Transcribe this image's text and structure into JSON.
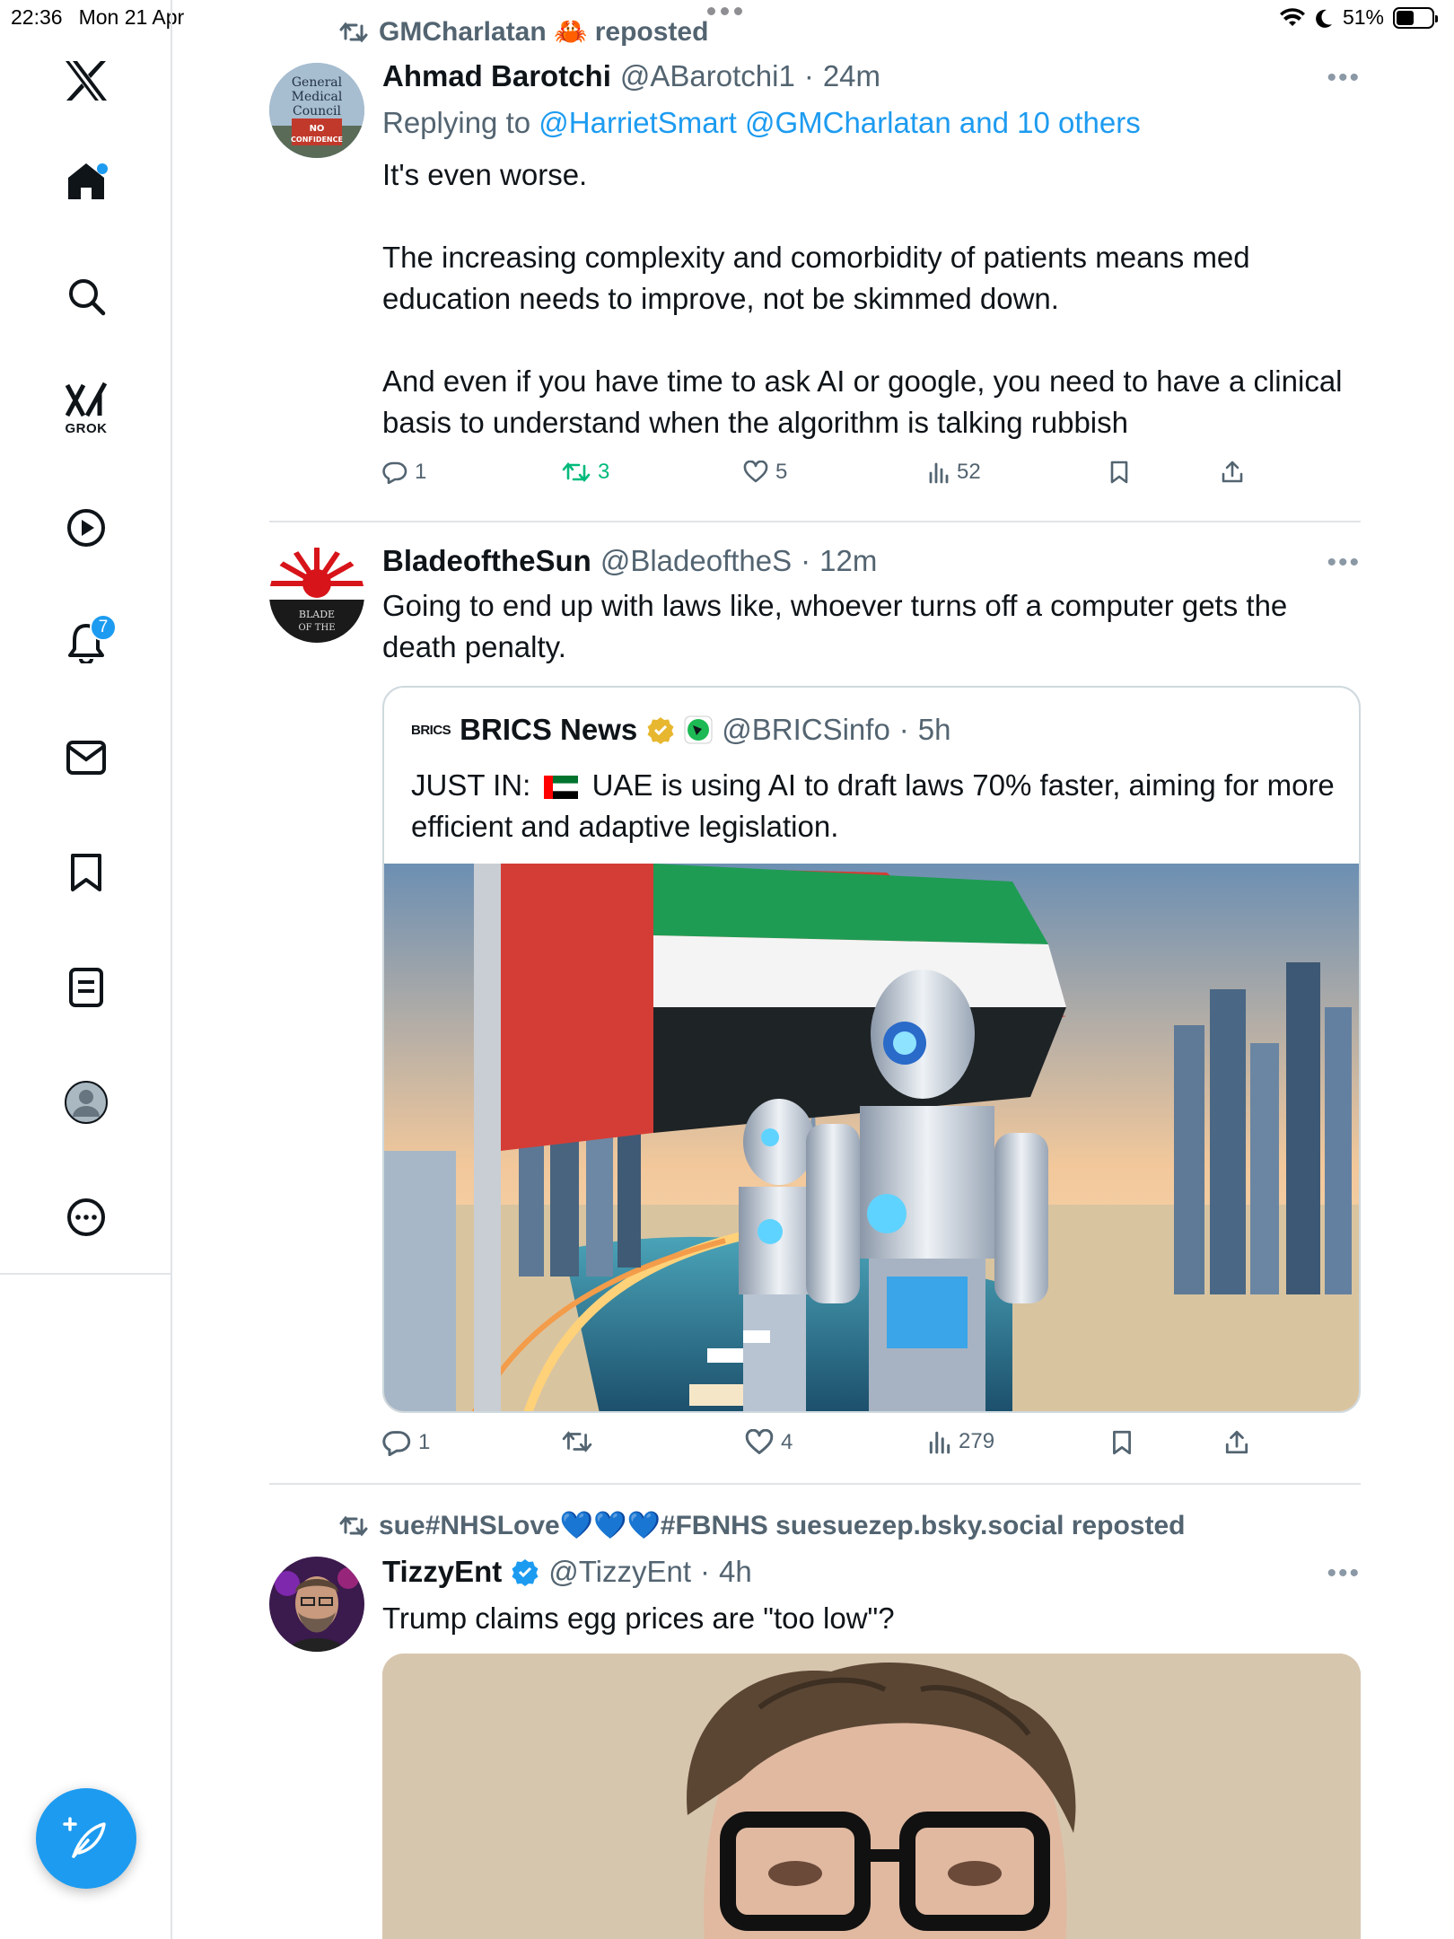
{
  "status_bar": {
    "time": "22:36",
    "date": "Mon 21 Apr",
    "battery": "51%"
  },
  "sidebar": {
    "items": [
      {
        "name": "x-logo"
      },
      {
        "name": "home"
      },
      {
        "name": "search"
      },
      {
        "name": "grok",
        "label": "GROK"
      },
      {
        "name": "videos"
      },
      {
        "name": "notifications",
        "badge": "7"
      },
      {
        "name": "messages"
      },
      {
        "name": "bookmarks"
      },
      {
        "name": "lists"
      },
      {
        "name": "profile"
      },
      {
        "name": "more"
      }
    ]
  },
  "posts": [
    {
      "repost_by": "GMCharlatan 🦀 reposted",
      "author": "Ahmad Barotchi",
      "handle": "@ABarotchi1",
      "time": "24m",
      "avatar_text": [
        "General",
        "Medical",
        "Council",
        "NO",
        "CONFIDENCE"
      ],
      "reply_prefix": "Replying to ",
      "reply_targets": "@HarrietSmart @GMCharlatan and 10 others",
      "text": "It's even worse.\n\nThe increasing complexity and comorbidity of patients means med education needs to improve, not be skimmed down.\n\nAnd even if you have time to ask AI or google, you need to have a clinical basis to understand when the algorithm is talking rubbish",
      "replies": "1",
      "reposts": "3",
      "likes": "5",
      "views": "52"
    },
    {
      "author": "BladeoftheSun",
      "handle": "@BladeoftheS",
      "time": "12m",
      "avatar_text": [
        "BLADE",
        "OF THE"
      ],
      "text": "Going to end up with laws like, whoever turns off a computer gets the death penalty.",
      "quote": {
        "logo": "BRICS",
        "author": "BRICS News",
        "handle": "@BRICSinfo",
        "time": "5h",
        "text_prefix": "JUST IN:",
        "text_body": "UAE is using AI to draft laws 70% faster, aiming for more efficient and adaptive legislation."
      },
      "replies": "1",
      "reposts": "",
      "likes": "4",
      "views": "279"
    },
    {
      "repost_by": "sue#NHSLove💙💙💙#FBNHS suesuezep.bsky.social reposted",
      "author": "TizzyEnt",
      "handle": "@TizzyEnt",
      "time": "4h",
      "text": "Trump claims egg prices are \"too low\"?"
    }
  ],
  "colors": {
    "accent": "#1d9bf0",
    "repost_green": "#00ba7c",
    "muted": "#536471"
  }
}
